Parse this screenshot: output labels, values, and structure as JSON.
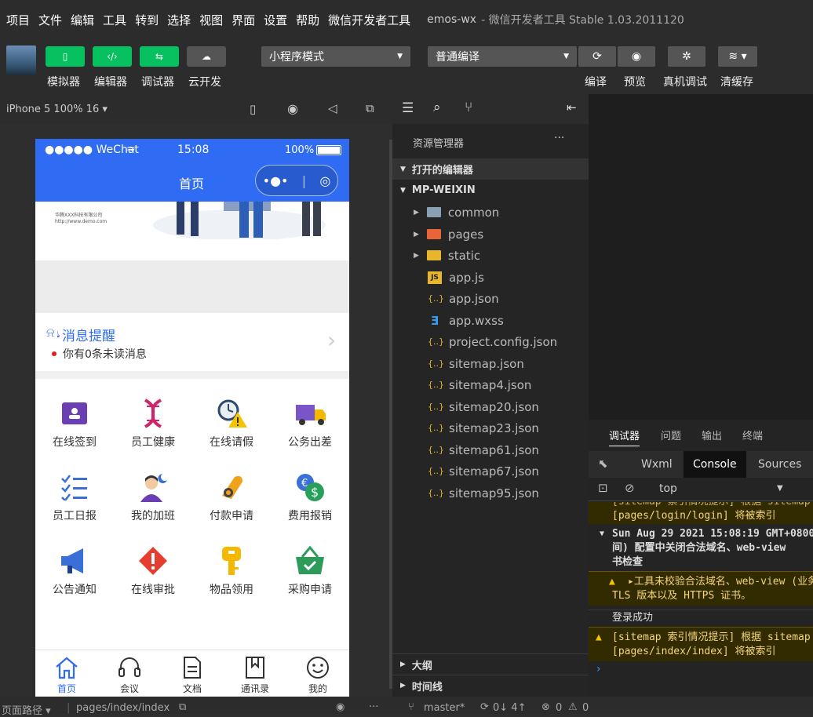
{
  "menu": {
    "items": [
      "项目",
      "文件",
      "编辑",
      "工具",
      "转到",
      "选择",
      "视图",
      "界面",
      "设置",
      "帮助",
      "微信开发者工具"
    ],
    "project": "emos-wx",
    "window_title": "- 微信开发者工具 Stable 1.03.2011120"
  },
  "toolbar": {
    "simulator": "模拟器",
    "editor": "编辑器",
    "debugger": "调试器",
    "cloud": "云开发",
    "mode_select": "小程序模式",
    "compile_select": "普通编译",
    "compile": "编译",
    "preview": "预览",
    "remote_debug": "真机调试",
    "clear_cache": "清缓存"
  },
  "simulator": {
    "device": "iPhone 5 100% 16 ▾"
  },
  "phone": {
    "carrier": "●●●●● WeChat",
    "time": "15:08",
    "battery": "100%",
    "nav_title": "首页",
    "banner_line1": "华腾XXX科技有限公司",
    "banner_line2": "http://www.demo.com",
    "msg_title": "消息提醒",
    "msg_text": "你有0条未读消息",
    "grid": [
      {
        "label": "在线签到",
        "icon": "checkin-icon"
      },
      {
        "label": "员工健康",
        "icon": "dna-icon"
      },
      {
        "label": "在线请假",
        "icon": "alarm-warning-icon"
      },
      {
        "label": "公务出差",
        "icon": "truck-icon"
      },
      {
        "label": "员工日报",
        "icon": "checklist-icon"
      },
      {
        "label": "我的加班",
        "icon": "overtime-person-icon"
      },
      {
        "label": "付款申请",
        "icon": "payment-hand-icon"
      },
      {
        "label": "费用报销",
        "icon": "dollar-coins-icon"
      },
      {
        "label": "公告通知",
        "icon": "megaphone-icon"
      },
      {
        "label": "在线审批",
        "icon": "approval-alert-icon"
      },
      {
        "label": "物品领用",
        "icon": "key-icon"
      },
      {
        "label": "采购申请",
        "icon": "basket-icon"
      }
    ],
    "tabs": [
      "首页",
      "会议",
      "文档",
      "通讯录",
      "我的"
    ]
  },
  "explorer": {
    "title": "资源管理器",
    "more": "···",
    "open_editors": "打开的编辑器",
    "project_root": "MP-WEIXIN",
    "folders": [
      "common",
      "pages",
      "static"
    ],
    "files": [
      "app.js",
      "app.json",
      "app.wxss",
      "project.config.json",
      "sitemap.json",
      "sitemap4.json",
      "sitemap20.json",
      "sitemap23.json",
      "sitemap61.json",
      "sitemap67.json",
      "sitemap95.json"
    ],
    "outline": "大纲",
    "timeline": "时间线"
  },
  "debugger": {
    "tabs": [
      "调试器",
      "问题",
      "输出",
      "终端"
    ],
    "devtabs": [
      "Wxml",
      "Console",
      "Sources"
    ],
    "context": "top",
    "logs": {
      "w0": "[sitemap 索引情况提示] 根据 sitemap",
      "w0b": "[pages/login/login] 将被索引",
      "d1": "Sun Aug 29 2021 15:08:19 GMT+0800",
      "d1b": "间) 配置中关闭合法域名、web-view",
      "d1c": "书检查",
      "w1": "▸工具未校验合法域名、web-view (业务域名)",
      "w1b": "TLS 版本以及 HTTPS 证书。",
      "ok": "登录成功",
      "w2": "[sitemap 索引情况提示] 根据 sitemap",
      "w2b": "[pages/index/index] 将被索引"
    }
  },
  "statusbar": {
    "page_path_label": "页面路径 ▾",
    "page_path": "pages/index/index",
    "branch": "master*",
    "sync": "0↓ 4↑",
    "errors": "0",
    "warnings": "0"
  }
}
